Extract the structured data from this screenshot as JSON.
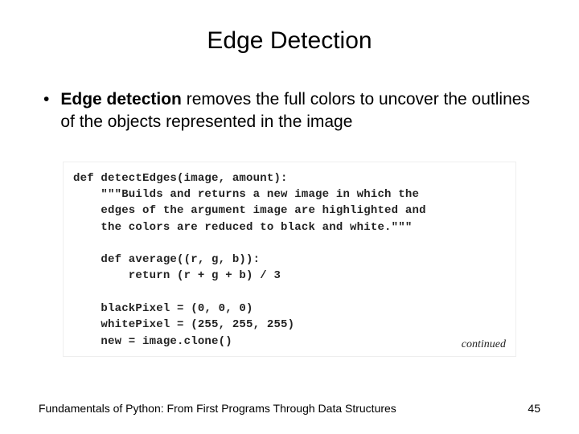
{
  "title": "Edge Detection",
  "bullet": {
    "bold": "Edge detection",
    "rest": " removes the full colors to uncover the outlines of the objects represented in the image"
  },
  "code": {
    "line1": "def detectEdges(image, amount):",
    "line2": "    \"\"\"Builds and returns a new image in which the",
    "line3": "    edges of the argument image are highlighted and",
    "line4": "    the colors are reduced to black and white.\"\"\"",
    "line5": "",
    "line6": "    def average((r, g, b)):",
    "line7": "        return (r + g + b) / 3",
    "line8": "",
    "line9": "    blackPixel = (0, 0, 0)",
    "line10": "    whitePixel = (255, 255, 255)",
    "line11": "    new = image.clone()"
  },
  "continued": "continued",
  "footer": {
    "text": "Fundamentals of Python: From First Programs Through Data Structures",
    "page": "45"
  }
}
